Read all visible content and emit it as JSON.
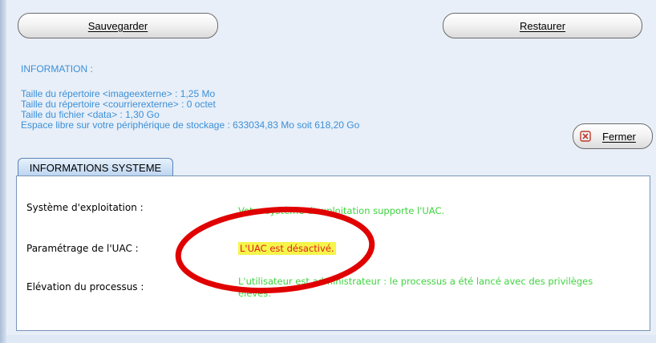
{
  "toolbar": {
    "save_label": "Sauvegarder",
    "restore_label": "Restaurer",
    "close_label": "Fermer"
  },
  "information": {
    "title": "INFORMATION :",
    "lines": [
      "Taille du répertoire <imageexterne> : 1,25 Mo",
      "Taille du répertoire <courrierexterne> : 0 octet",
      "Taille du fichier <data> : 1,30 Go",
      "Espace libre sur votre périphérique de stockage : 633034,83 Mo soit 618,20 Go"
    ]
  },
  "tab": {
    "label": "INFORMATIONS SYSTEME"
  },
  "system": {
    "os_label": "Système d'exploitation :",
    "os_value": "Votre système d'exploitation supporte l'UAC.",
    "uac_label": "Paramétrage de l'UAC :",
    "uac_value": "L'UAC est désactivé.",
    "elev_label": "Elévation du processus :",
    "elev_value_line1": "L'utilisateur est administrateur : le processus a été lancé avec des privilèges",
    "elev_value_line2": "élevés."
  },
  "colors": {
    "info_text": "#3b8fd8",
    "ok_text": "#3fd33f",
    "warn_text": "#e02020",
    "highlight": "#f5f54a",
    "annotation": "#e00000"
  },
  "icons": {
    "close": "close-x-icon"
  }
}
